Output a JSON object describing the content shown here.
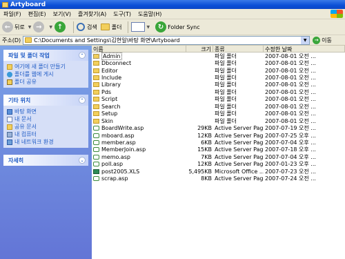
{
  "window": {
    "title": "Artyboard"
  },
  "menu": [
    "파일(F)",
    "편집(E)",
    "보기(V)",
    "즐겨찾기(A)",
    "도구(T)",
    "도움말(H)"
  ],
  "toolbar": {
    "back": "뒤로",
    "search": "검색",
    "folders": "폴더",
    "folder_sync": "Folder Sync"
  },
  "address": {
    "label": "주소(D)",
    "path": "C:\\Documents and Settings\\김현일\\바탕 화면\\Artyboard",
    "go": "이동"
  },
  "sidebar": {
    "file_tasks": {
      "title": "파일 및 폴더 작업",
      "items": [
        "여기에 새 폴더 만들기",
        "폴더를 웹에 게시",
        "폴더 공유"
      ]
    },
    "other_places": {
      "title": "기타 위치",
      "items": [
        "바탕 화면",
        "내 문서",
        "공유 문서",
        "내 컴퓨터",
        "내 네트워크 환경"
      ]
    },
    "details": {
      "title": "자세히"
    }
  },
  "columns": {
    "name": "이름",
    "size": "크기",
    "type": "종류",
    "date": "수정한 날짜"
  },
  "files": [
    {
      "name": "Admin",
      "size": "",
      "type": "파일 폴더",
      "date": "2007-08-01 오전 ...",
      "kind": "folder"
    },
    {
      "name": "Dbconnect",
      "size": "",
      "type": "파일 폴더",
      "date": "2007-08-01 오전 ...",
      "kind": "folder"
    },
    {
      "name": "Editor",
      "size": "",
      "type": "파일 폴더",
      "date": "2007-08-01 오전 ...",
      "kind": "folder"
    },
    {
      "name": "Include",
      "size": "",
      "type": "파일 폴더",
      "date": "2007-08-01 오전 ...",
      "kind": "folder"
    },
    {
      "name": "Library",
      "size": "",
      "type": "파일 폴더",
      "date": "2007-08-01 오전 ...",
      "kind": "folder"
    },
    {
      "name": "Pds",
      "size": "",
      "type": "파일 폴더",
      "date": "2007-08-01 오전 ...",
      "kind": "folder"
    },
    {
      "name": "Script",
      "size": "",
      "type": "파일 폴더",
      "date": "2007-08-01 오전 ...",
      "kind": "folder"
    },
    {
      "name": "Search",
      "size": "",
      "type": "파일 폴더",
      "date": "2007-08-01 오전 ...",
      "kind": "folder"
    },
    {
      "name": "Setup",
      "size": "",
      "type": "파일 폴더",
      "date": "2007-08-01 오전 ...",
      "kind": "folder"
    },
    {
      "name": "Skin",
      "size": "",
      "type": "파일 폴더",
      "date": "2007-08-01 오전 ...",
      "kind": "folder"
    },
    {
      "name": "BoardWrite.asp",
      "size": "29KB",
      "type": "Active Server Page",
      "date": "2007-07-19 오전 ...",
      "kind": "asp"
    },
    {
      "name": "mboard.asp",
      "size": "12KB",
      "type": "Active Server Page",
      "date": "2007-07-25 오후 ...",
      "kind": "asp"
    },
    {
      "name": "member.asp",
      "size": "6KB",
      "type": "Active Server Page",
      "date": "2007-07-04 오후 ...",
      "kind": "asp"
    },
    {
      "name": "MemberJoin.asp",
      "size": "15KB",
      "type": "Active Server Page",
      "date": "2007-07-18 오후 ...",
      "kind": "asp"
    },
    {
      "name": "memo.asp",
      "size": "7KB",
      "type": "Active Server Page",
      "date": "2007-07-04 오후 ...",
      "kind": "asp"
    },
    {
      "name": "poll.asp",
      "size": "12KB",
      "type": "Active Server Page",
      "date": "2007-01-23 오후 ...",
      "kind": "asp"
    },
    {
      "name": "post2005.XLS",
      "size": "5,495KB",
      "type": "Microsoft Office ...",
      "date": "2007-07-23 오전 ...",
      "kind": "xls"
    },
    {
      "name": "scrap.asp",
      "size": "8KB",
      "type": "Active Server Page",
      "date": "2007-07-24 오전 ...",
      "kind": "asp"
    }
  ],
  "colors": {
    "titlebar": "#0a4fd6",
    "sidebar": "#6f8fe0",
    "link": "#215dc6"
  }
}
